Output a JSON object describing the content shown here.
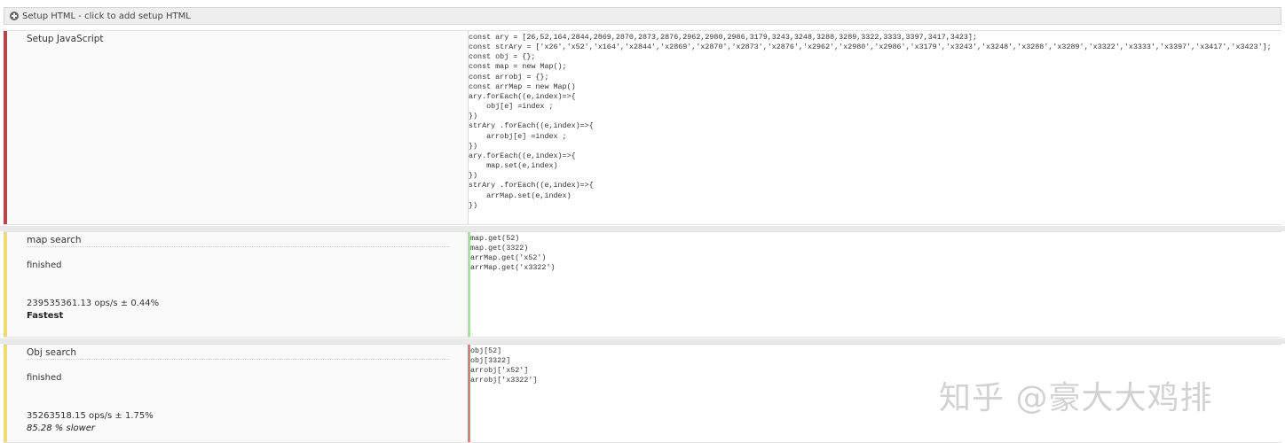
{
  "topbar": {
    "label": "Setup HTML - click to add setup HTML",
    "icon": "plus-circle-icon"
  },
  "setup": {
    "title": "Setup JavaScript",
    "code": "const ary = [26,52,164,2844,2869,2870,2873,2876,2962,2980,2986,3179,3243,3248,3288,3289,3322,3333,3397,3417,3423];\nconst strAry = ['x26','x52','x164','x2844','x2869','x2870','x2873','x2876','x2962','x2980','x2986','x3179','x3243','x3248','x3288','x3289','x3322','x3333','x3397','x3417','x3423'];\nconst obj = {};\nconst map = new Map();\nconst arrobj = {};\nconst arrMap = new Map()\nary.forEach((e,index)=>{\n    obj[e] =index ;\n})\nstrAry .forEach((e,index)=>{\n    arrobj[e] =index ;\n})\nary.forEach((e,index)=>{\n    map.set(e,index)\n})\nstrAry .forEach((e,index)=>{\n    arrMap.set(e,index)\n})"
  },
  "tests": [
    {
      "title": "map search",
      "status": "finished",
      "ops": "239535361.13 ops/s ± 0.44%",
      "note": "Fastest",
      "code": "map.get(52)\nmap.get(3322)\narrMap.get('x52')\narrMap.get('x3322')",
      "color": "#a8e0a0"
    },
    {
      "title": "Obj search",
      "status": "finished",
      "ops": "35263518.15 ops/s ± 1.75%",
      "note": "85.28 % slower",
      "code": "obj[52]\nobj[3322]\narrobj['x52']\narrobj['x3322']",
      "color": "#e07c7c"
    }
  ],
  "colors": {
    "setup_border": "#b04a4a",
    "status_border": "#f0d878"
  },
  "watermark": "知乎 @豪大大鸡排"
}
